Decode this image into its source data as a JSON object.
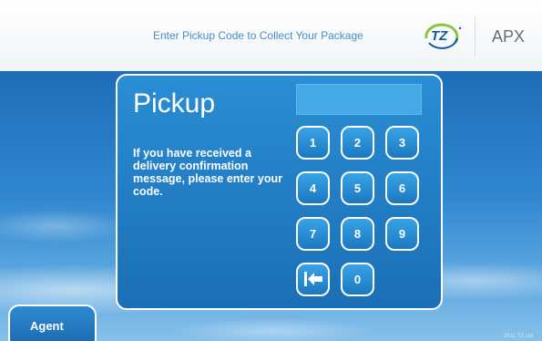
{
  "header": {
    "instruction": "Enter Pickup Code to Collect Your Package",
    "logo_text": "TZ",
    "brand": "APX"
  },
  "panel": {
    "title": "Pickup",
    "message": "If you have received a delivery confirmation message, please enter your code.",
    "code_value": ""
  },
  "keypad": {
    "keys": [
      "1",
      "2",
      "3",
      "4",
      "5",
      "6",
      "7",
      "8",
      "9",
      "0"
    ],
    "backspace_icon": "backspace-arrow-icon"
  },
  "footer": {
    "agent_label": "Agent",
    "copyright": "2011 TZ Ltd"
  },
  "colors": {
    "brand_blue": "#1b6fb6",
    "header_text": "#4a8cc8",
    "logo_green": "#8cc63f"
  }
}
